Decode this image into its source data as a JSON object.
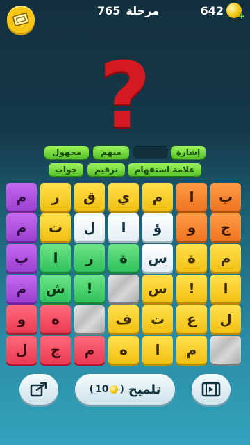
{
  "header": {
    "level_label": "مرحلة",
    "level_number": "765",
    "coins": "642"
  },
  "clue": {
    "symbol": "?"
  },
  "answer_slots": [
    {
      "text": "إشارة",
      "empty": false
    },
    {
      "text": "",
      "empty": true
    },
    {
      "text": "مبهم",
      "empty": false
    },
    {
      "text": "مجهول",
      "empty": false
    },
    {
      "text": "علامة استفهام",
      "empty": false
    },
    {
      "text": "ترقيم",
      "empty": false
    },
    {
      "text": "جواب",
      "empty": false
    }
  ],
  "grid": {
    "columns": 7,
    "rows": [
      [
        {
          "l": "ب",
          "c": "orange"
        },
        {
          "l": "ا",
          "c": "orange"
        },
        {
          "l": "م",
          "c": "yellow"
        },
        {
          "l": "ي",
          "c": "yellow"
        },
        {
          "l": "ق",
          "c": "yellow"
        },
        {
          "l": "ر",
          "c": "yellow"
        },
        {
          "l": "م",
          "c": "purple"
        }
      ],
      [
        {
          "l": "ج",
          "c": "orange"
        },
        {
          "l": "و",
          "c": "orange"
        },
        {
          "l": "ؤ",
          "c": "white"
        },
        {
          "l": "ا",
          "c": "white"
        },
        {
          "l": "ل",
          "c": "white"
        },
        {
          "l": "ت",
          "c": "yellow"
        },
        {
          "l": "م",
          "c": "purple"
        }
      ],
      [
        {
          "l": "م",
          "c": "yellow"
        },
        {
          "l": "ة",
          "c": "yellow"
        },
        {
          "l": "س",
          "c": "white"
        },
        {
          "l": "ة",
          "c": "green"
        },
        {
          "l": "ر",
          "c": "green"
        },
        {
          "l": "ا",
          "c": "green"
        },
        {
          "l": "ب",
          "c": "purple"
        }
      ],
      [
        {
          "l": "ا",
          "c": "yellow"
        },
        {
          "l": "!",
          "c": "yellow"
        },
        {
          "l": "س",
          "c": "yellow"
        },
        {
          "l": "",
          "c": "stone"
        },
        {
          "l": "!",
          "c": "green"
        },
        {
          "l": "ش",
          "c": "green"
        },
        {
          "l": "م",
          "c": "purple"
        }
      ],
      [
        {
          "l": "ل",
          "c": "yellow"
        },
        {
          "l": "ع",
          "c": "yellow"
        },
        {
          "l": "ت",
          "c": "yellow"
        },
        {
          "l": "ف",
          "c": "yellow"
        },
        {
          "l": "",
          "c": "stone"
        },
        {
          "l": "ه",
          "c": "red"
        },
        {
          "l": "و",
          "c": "red"
        }
      ],
      [
        {
          "l": "",
          "c": "stone"
        },
        {
          "l": "م",
          "c": "yellow"
        },
        {
          "l": "ا",
          "c": "yellow"
        },
        {
          "l": "ه",
          "c": "yellow"
        },
        {
          "l": "م",
          "c": "red"
        },
        {
          "l": "ج",
          "c": "red"
        },
        {
          "l": "ل",
          "c": "red"
        }
      ]
    ]
  },
  "bottom": {
    "hint_label": "تلميح",
    "hint_cost": "10"
  },
  "icons": {
    "ticket": "ticket-icon",
    "coin": "coin-icon",
    "share": "share-icon",
    "video": "video-icon"
  },
  "colors": {
    "qmark": "#d31a20",
    "slot_green": "#6edb3d",
    "gold": "#f5c518"
  }
}
